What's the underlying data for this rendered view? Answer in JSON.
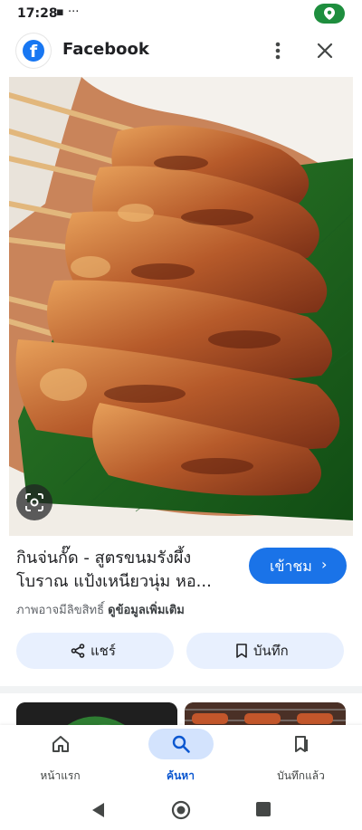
{
  "status_bar": {
    "time": "17:28",
    "extra_icons": "▪ ···"
  },
  "app_bar": {
    "title": "Facebook",
    "logo_letter": "f"
  },
  "result": {
    "title": "กินจ่นกั๊ด - สูตรขนมรังผึ้งโบราณ แป้งเหนียวนุ่ม หอ...",
    "visit_label": "เข้าชม",
    "copyright_text": "ภาพอาจมีลิขสิทธิ์",
    "more_info_label": "ดูข้อมูลเพิ่มเติม"
  },
  "actions": {
    "share_label": "แชร์",
    "save_label": "บันทึก"
  },
  "bottom_nav": {
    "items": [
      {
        "label": "หน้าแรก",
        "icon": "home-icon"
      },
      {
        "label": "ค้นหา",
        "icon": "search-icon"
      },
      {
        "label": "บันทึกแล้ว",
        "icon": "bookmarks-icon"
      }
    ],
    "active_index": 1
  },
  "colors": {
    "accent": "#1a73e8",
    "chip_bg": "#e8f0fe",
    "active_nav": "#0b57d0",
    "location_pill": "#1e8e3e"
  }
}
